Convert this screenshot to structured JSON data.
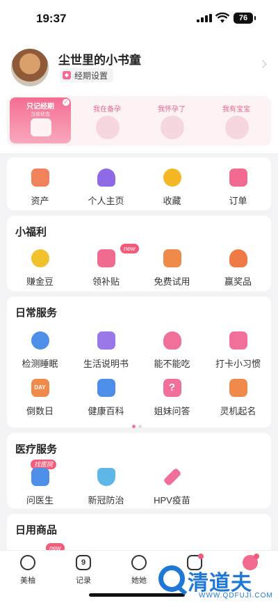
{
  "status_bar": {
    "time": "19:37",
    "battery": "76"
  },
  "profile": {
    "username": "尘世里的小书童",
    "period_settings": "经期设置",
    "stages": [
      {
        "label": "只记经期",
        "sub": "当前状态",
        "active": true
      },
      {
        "label": "我在备孕",
        "active": false
      },
      {
        "label": "我怀孕了",
        "active": false
      },
      {
        "label": "我有宝宝",
        "active": false
      }
    ]
  },
  "quick_links": [
    {
      "label": "资产",
      "icon": "wallet-icon",
      "color": "#f0825c"
    },
    {
      "label": "个人主页",
      "icon": "person-icon",
      "color": "#8f6ae6"
    },
    {
      "label": "收藏",
      "icon": "star-icon",
      "color": "#f4b824"
    },
    {
      "label": "订单",
      "icon": "order-icon",
      "color": "#f06b8f"
    }
  ],
  "welfare": {
    "title": "小福利",
    "items": [
      {
        "label": "赚金豆",
        "icon": "bean-icon",
        "color": "#f1c22c"
      },
      {
        "label": "领补贴",
        "icon": "subsidy-icon",
        "color": "#f06b8f",
        "badge": "new"
      },
      {
        "label": "免费试用",
        "icon": "trial-bag-icon",
        "color": "#f08a4b"
      },
      {
        "label": "赢奖品",
        "icon": "prize-bag-icon",
        "color": "#f07a45"
      }
    ]
  },
  "daily": {
    "title": "日常服务",
    "items": [
      {
        "label": "检测睡眠",
        "icon": "sleep-icon",
        "color": "#4d8fe8"
      },
      {
        "label": "生活说明书",
        "icon": "manual-icon",
        "color": "#9b78e8"
      },
      {
        "label": "能不能吃",
        "icon": "food-icon",
        "color": "#f0709a"
      },
      {
        "label": "打卡小习惯",
        "icon": "checkin-icon",
        "color": "#f0709a"
      },
      {
        "label": "倒数日",
        "icon": "countdown-icon",
        "color": "#f08a4b",
        "icon_text": "DAY"
      },
      {
        "label": "健康百科",
        "icon": "encyclopedia-icon",
        "color": "#4d8fe8"
      },
      {
        "label": "姐妹问答",
        "icon": "question-icon",
        "color": "#f0709a",
        "icon_text": "?"
      },
      {
        "label": "灵机起名",
        "icon": "naming-icon",
        "color": "#f08a4b"
      }
    ]
  },
  "medical": {
    "title": "医疗服务",
    "items": [
      {
        "label": "问医生",
        "icon": "doctor-icon",
        "color": "#4d8fe8",
        "badge": "找医院"
      },
      {
        "label": "新冠防治",
        "icon": "covid-shield-icon",
        "color": "#5fb7e8"
      },
      {
        "label": "HPV疫苗",
        "icon": "vaccine-icon",
        "color": "#f0709a"
      }
    ]
  },
  "goods": {
    "title": "日用商品",
    "peek_badge": "new"
  },
  "tabbar": [
    {
      "label": "美柚",
      "icon": "meiyou-icon"
    },
    {
      "label": "记录",
      "icon": "calendar-icon",
      "icon_text": "9"
    },
    {
      "label": "她她",
      "icon": "community-icon"
    },
    {
      "label": "",
      "icon": "shop-icon"
    },
    {
      "label": "",
      "icon": "me-icon"
    }
  ],
  "watermark": {
    "text": "清道夫",
    "url": "WWW.QDFUJI.COM"
  }
}
